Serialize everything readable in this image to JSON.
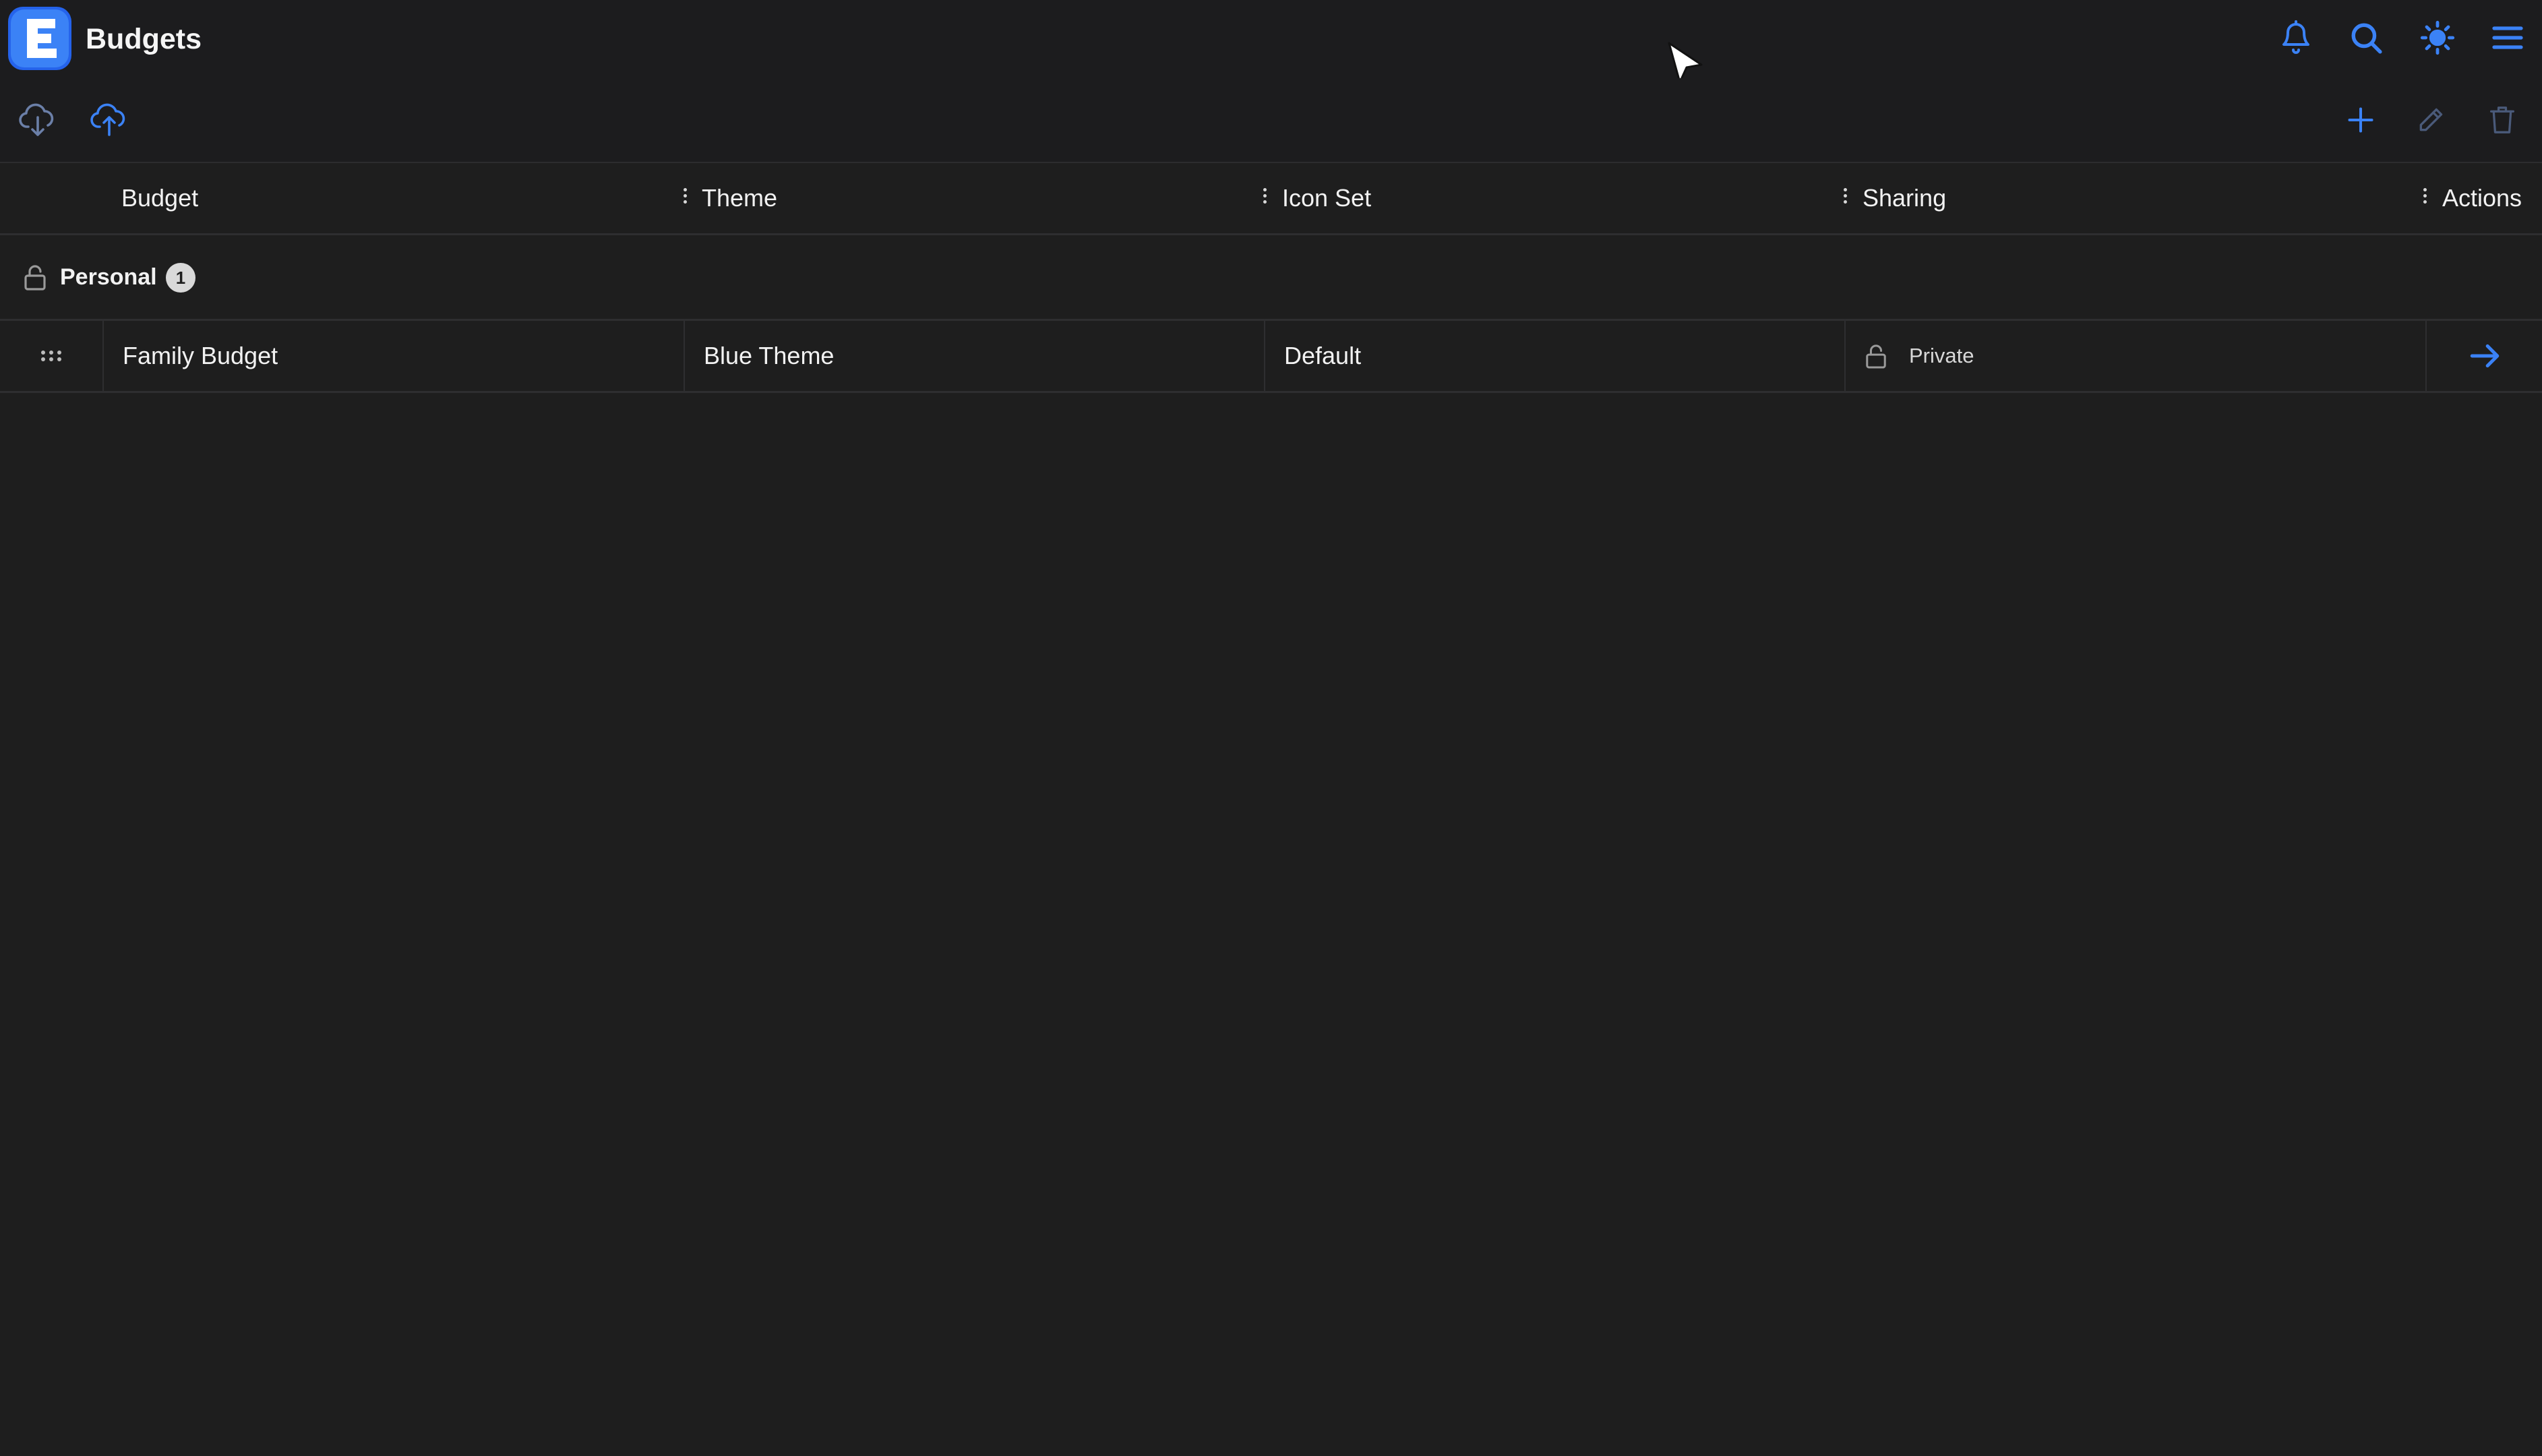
{
  "header": {
    "logo_letter": "E",
    "title": "Budgets",
    "icons": [
      "bell-icon",
      "search-icon",
      "sun-icon",
      "menu-icon"
    ]
  },
  "toolbar": {
    "left_icons": [
      "cloud-download-icon",
      "cloud-upload-icon"
    ],
    "right_icons": [
      "plus-icon",
      "pencil-icon",
      "trash-icon"
    ]
  },
  "table": {
    "columns": [
      "Budget",
      "Theme",
      "Icon Set",
      "Sharing",
      "Actions"
    ],
    "groups": [
      {
        "name": "Personal",
        "count": "1",
        "rows": [
          {
            "budget": "Family Budget",
            "theme": "Blue Theme",
            "icon_set": "Default",
            "sharing": "Private"
          }
        ]
      }
    ]
  },
  "colors": {
    "background": "#1e1e1e",
    "accent": "#3b82f6",
    "logo": "#2563eb",
    "border": "#2e2e30",
    "text": "#f2f2f2"
  }
}
